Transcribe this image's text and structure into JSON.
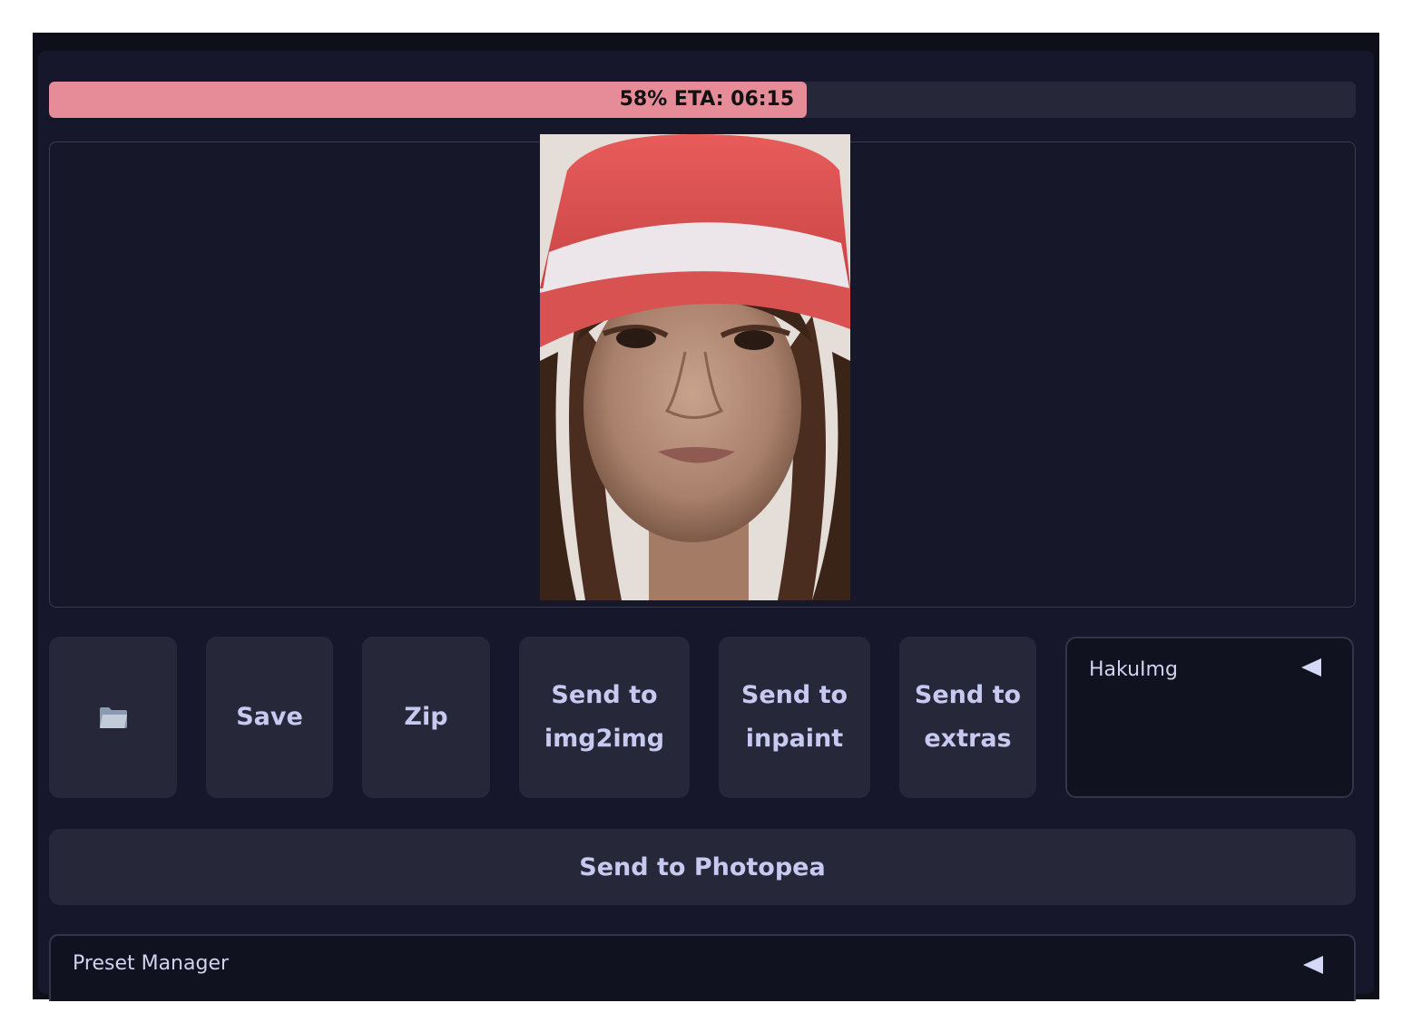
{
  "progress": {
    "percent": 58,
    "text": "58% ETA: 06:15",
    "fill_color": "#e68b98"
  },
  "gallery": {
    "image_icon": "generated-portrait"
  },
  "buttons": {
    "folder_icon": "folder-icon",
    "save": "Save",
    "zip": "Zip",
    "send_img2img": "Send to img2img",
    "send_inpaint": "Send to inpaint",
    "send_extras": "Send to extras",
    "send_photopea": "Send to Photopea"
  },
  "accordions": {
    "hakuimg": "HakuImg",
    "preset_manager": "Preset Manager"
  },
  "colors": {
    "background": "#16172a",
    "button": "#262738",
    "button_text": "#c7c9f0"
  }
}
